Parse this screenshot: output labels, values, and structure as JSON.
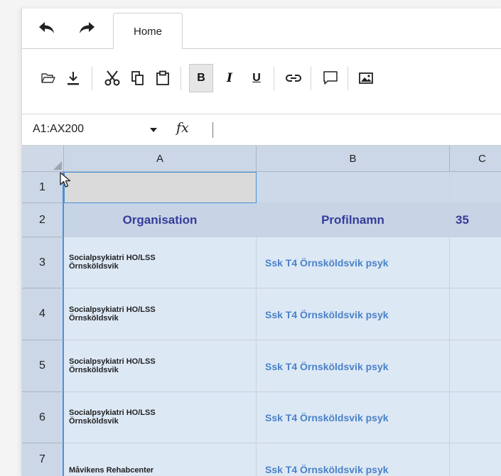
{
  "toolbar": {
    "undo_icon": "undo-icon",
    "redo_icon": "redo-icon",
    "tabs": [
      {
        "label": "Home",
        "active": true
      }
    ]
  },
  "ribbon": {
    "buttons": [
      "open-icon",
      "download-icon",
      "cut-icon",
      "copy-icon",
      "paste-icon",
      "bold",
      "italic",
      "underline",
      "link-icon",
      "comment-icon",
      "image-icon"
    ],
    "bold_label": "B",
    "italic_label": "I",
    "underline_label": "U"
  },
  "formula_bar": {
    "name_box": "A1:AX200",
    "fx_label": "fx",
    "formula": ""
  },
  "grid": {
    "columns": [
      "A",
      "B",
      "C"
    ],
    "rows": [
      {
        "num": "1",
        "a": "",
        "b": "",
        "c": ""
      },
      {
        "num": "2",
        "a": "Organisation",
        "b": "Profilnamn",
        "c": "35"
      },
      {
        "num": "3",
        "a_line1": "Socialpsykiatri HO/LSS",
        "a_line2": "Örnsköldsvik",
        "b": "Ssk T4 Örnsköldsvik psyk"
      },
      {
        "num": "4",
        "a_line1": "Socialpsykiatri HO/LSS",
        "a_line2": "Örnsköldsvik",
        "b": "Ssk T4 Örnsköldsvik psyk"
      },
      {
        "num": "5",
        "a_line1": "Socialpsykiatri HO/LSS",
        "a_line2": "Örnsköldsvik",
        "b": "Ssk T4 Örnsköldsvik psyk"
      },
      {
        "num": "6",
        "a_line1": "Socialpsykiatri HO/LSS",
        "a_line2": "Örnsköldsvik",
        "b": "Ssk T4 Örnsköldsvik psyk"
      },
      {
        "num": "7",
        "a_line1": "Måvikens Rehabcenter",
        "b": "Ssk T4 Örnsköldsvik psyk"
      }
    ]
  },
  "colors": {
    "accent": "#4a90d9",
    "header_text": "#3a3a9a",
    "link_text": "#4a82c8"
  }
}
